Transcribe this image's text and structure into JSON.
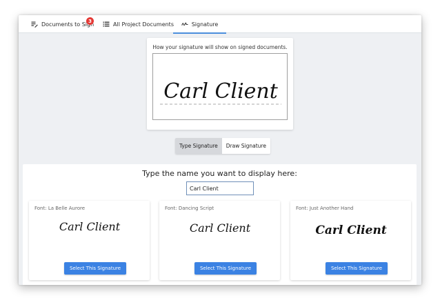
{
  "tabs": [
    {
      "label": "Documents to Sign",
      "icon": "edit-list-icon",
      "badge": "3"
    },
    {
      "label": "All Project Documents",
      "icon": "list-icon"
    },
    {
      "label": "Signature",
      "icon": "signature-icon",
      "active": true
    }
  ],
  "preview": {
    "caption": "How your signature will show on signed documents.",
    "signature_text": "Carl Client"
  },
  "mode_toggle": {
    "options": [
      "Type Signature",
      "Draw Signature"
    ],
    "selected": "Type Signature"
  },
  "type_panel": {
    "heading": "Type the name you want to display here:",
    "input_value": "Carl Client"
  },
  "font_options": [
    {
      "label": "Font: La Belle Aurore",
      "sample": "Carl Client",
      "button": "Select This Signature"
    },
    {
      "label": "Font: Dancing Script",
      "sample": "Carl Client",
      "button": "Select This Signature"
    },
    {
      "label": "Font: Just Another Hand",
      "sample": "Carl Client",
      "button": "Select This Signature"
    }
  ],
  "colors": {
    "accent": "#3b82e3",
    "badge": "#e53935",
    "tab_underline": "#4a8ddc",
    "background": "#eef0f3"
  }
}
